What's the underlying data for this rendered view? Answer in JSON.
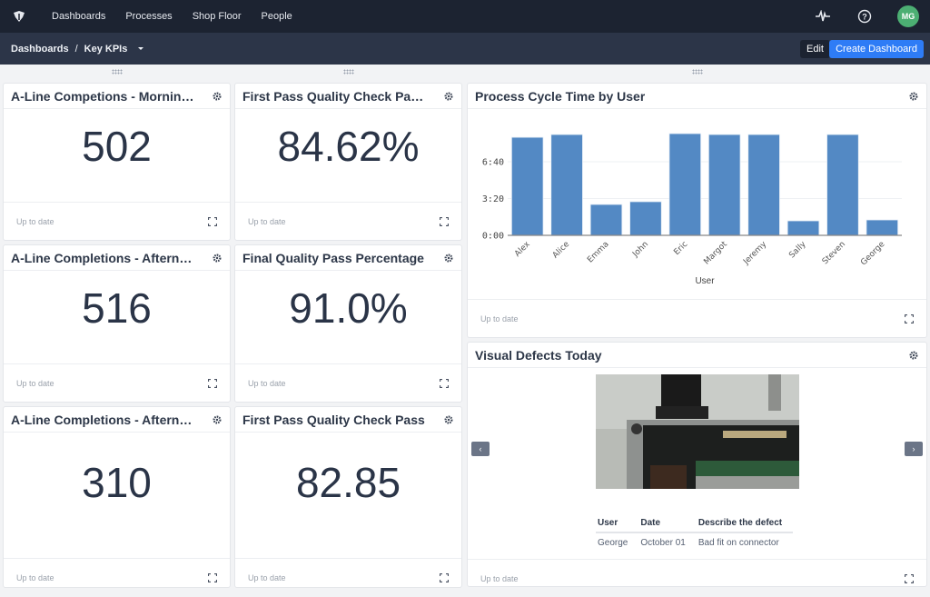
{
  "topnav": {
    "items": [
      "Dashboards",
      "Processes",
      "Shop Floor",
      "People"
    ],
    "user_initials": "MG",
    "avatar_color": "#4caf73"
  },
  "subbar": {
    "breadcrumb_root": "Dashboards",
    "separator": "/",
    "current": "Key KPIs",
    "edit_label": "Edit",
    "create_label": "Create Dashboard",
    "accent": "#2e7cf6"
  },
  "kpi_cards": [
    {
      "title": "A-Line Competions - Morning Shift",
      "value": "502",
      "status": "Up to date"
    },
    {
      "title": "First Pass Quality Check Pass Rate",
      "value": "84.62%",
      "status": "Up to date"
    },
    {
      "title": "A-Line Completions - Afternoon Shift",
      "value": "516",
      "status": "Up to date"
    },
    {
      "title": "Final Quality Pass Percentage",
      "value": "91.0%",
      "status": "Up to date"
    },
    {
      "title": "A-Line Completions - Afternoon Shift",
      "value": "310",
      "status": "Up to date"
    },
    {
      "title": "First Pass Quality Check Pass",
      "value": "82.85",
      "status": "Up to date"
    }
  ],
  "chart_card": {
    "title": "Process Cycle Time by User",
    "status": "Up to date"
  },
  "chart_data": {
    "type": "bar",
    "title": "Process Cycle Time by User",
    "xlabel": "User",
    "ylabel": "",
    "categories": [
      "Alex",
      "Alice",
      "Emma",
      "John",
      "Eric",
      "Margot",
      "Jeremy",
      "Sally",
      "Steven",
      "George"
    ],
    "values_seconds": [
      533,
      548,
      168,
      183,
      553,
      548,
      548,
      79,
      548,
      84
    ],
    "yticks": [
      {
        "value": 0,
        "label": "0:00"
      },
      {
        "value": 200,
        "label": "3:20"
      },
      {
        "value": 400,
        "label": "6:40"
      }
    ],
    "ylim": [
      0,
      600
    ],
    "grid": true,
    "bar_color": "#5389c4"
  },
  "defects_card": {
    "title": "Visual Defects Today",
    "status": "Up to date",
    "prev_label": "‹",
    "next_label": "›",
    "columns": [
      "User",
      "Date",
      "Describe the defect"
    ],
    "rows": [
      [
        "George",
        "October 01",
        "Bad fit on connector"
      ]
    ]
  }
}
